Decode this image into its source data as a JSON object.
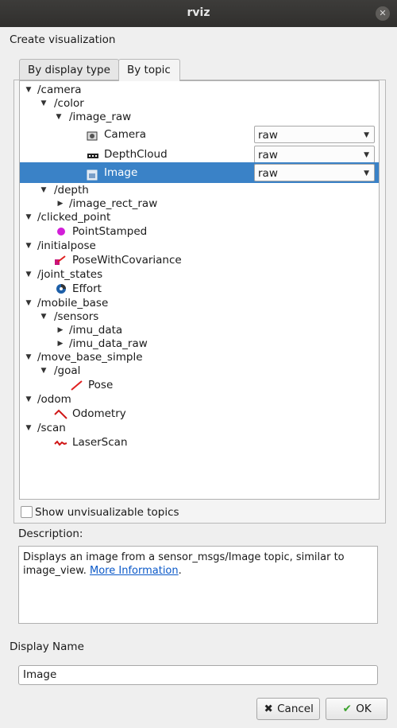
{
  "window": {
    "title": "rviz"
  },
  "dialog": {
    "heading": "Create visualization",
    "tabs": [
      {
        "label": "By display type",
        "active": false
      },
      {
        "label": "By topic",
        "active": true
      }
    ],
    "show_unvisualizable": {
      "label": "Show unvisualizable topics",
      "checked": false
    },
    "description": {
      "label": "Description:",
      "text": "Displays an image from a sensor_msgs/Image topic, similar to image_view.",
      "link_text": "More Information",
      "trailing": "."
    },
    "display_name": {
      "label": "Display Name",
      "value": "Image"
    },
    "buttons": {
      "cancel": "Cancel",
      "ok": "OK"
    }
  },
  "tree": [
    {
      "label": "/camera",
      "expanded": true
    },
    {
      "label": "/color",
      "expanded": true
    },
    {
      "label": "/image_raw",
      "expanded": true
    },
    {
      "label": "Camera",
      "icon": "camera-icon",
      "combo": "raw"
    },
    {
      "label": "DepthCloud",
      "icon": "depthcloud-icon",
      "combo": "raw"
    },
    {
      "label": "Image",
      "icon": "image-icon",
      "combo": "raw",
      "selected": true
    },
    {
      "label": "/depth",
      "expanded": true
    },
    {
      "label": "/image_rect_raw",
      "expanded": false
    },
    {
      "label": "/clicked_point",
      "expanded": true
    },
    {
      "label": "PointStamped",
      "icon": "point-icon"
    },
    {
      "label": "/initialpose",
      "expanded": true
    },
    {
      "label": "PoseWithCovariance",
      "icon": "pose-covariance-icon"
    },
    {
      "label": "/joint_states",
      "expanded": true
    },
    {
      "label": "Effort",
      "icon": "effort-icon"
    },
    {
      "label": "/mobile_base",
      "expanded": true
    },
    {
      "label": "/sensors",
      "expanded": true
    },
    {
      "label": "/imu_data",
      "expanded": false
    },
    {
      "label": "/imu_data_raw",
      "expanded": false
    },
    {
      "label": "/move_base_simple",
      "expanded": true
    },
    {
      "label": "/goal",
      "expanded": true
    },
    {
      "label": "Pose",
      "icon": "pose-icon"
    },
    {
      "label": "/odom",
      "expanded": true
    },
    {
      "label": "Odometry",
      "icon": "odometry-icon"
    },
    {
      "label": "/scan",
      "expanded": true
    },
    {
      "label": "LaserScan",
      "icon": "laserscan-icon"
    }
  ]
}
